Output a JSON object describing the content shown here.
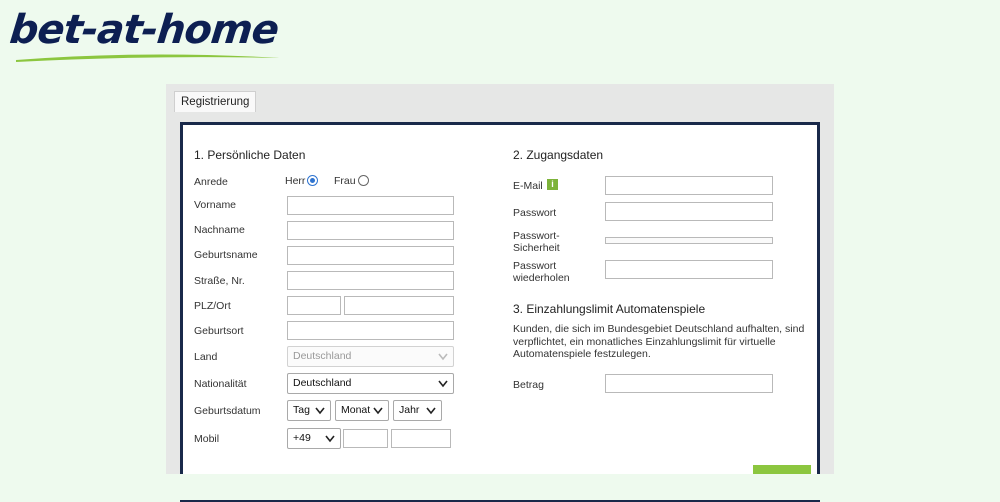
{
  "brand": {
    "logo_text": "bet-at-home",
    "colors": {
      "navy": "#0d1f52",
      "green": "#8cc63f"
    }
  },
  "tab": {
    "label": "Registrierung"
  },
  "personal": {
    "title": "1. Persönliche Daten",
    "anrede_label": "Anrede",
    "herr_label": "Herr",
    "frau_label": "Frau",
    "selected_anrede": "Herr",
    "vorname_label": "Vorname",
    "nachname_label": "Nachname",
    "geburtsname_label": "Geburtsname",
    "strasse_label": "Straße, Nr.",
    "plz_label": "PLZ/Ort",
    "geburtsort_label": "Geburtsort",
    "land_label": "Land",
    "land_value": "Deutschland",
    "nationalitaet_label": "Nationalität",
    "nationalitaet_value": "Deutschland",
    "geburtsdatum_label": "Geburtsdatum",
    "tag_value": "Tag",
    "monat_value": "Monat",
    "jahr_value": "Jahr",
    "mobil_label": "Mobil",
    "mobil_prefix": "+49"
  },
  "access": {
    "title": "2. Zugangsdaten",
    "email_label": "E-Mail",
    "info_icon": "i",
    "passwort_label": "Passwort",
    "sicherheit_label_line1": "Passwort-",
    "sicherheit_label_line2": "Sicherheit",
    "wiederholen_label_line1": "Passwort",
    "wiederholen_label_line2": "wiederholen"
  },
  "limit": {
    "title": "3. Einzahlungslimit Automatenspiele",
    "text_line1": "Kunden, die sich im Bundesgebiet Deutschland aufhalten, sind",
    "text_line2": "verpflichtet, ein monatliches Einzahlungslimit für virtuelle",
    "text_line3": "Automatenspiele festzulegen.",
    "betrag_label": "Betrag"
  }
}
